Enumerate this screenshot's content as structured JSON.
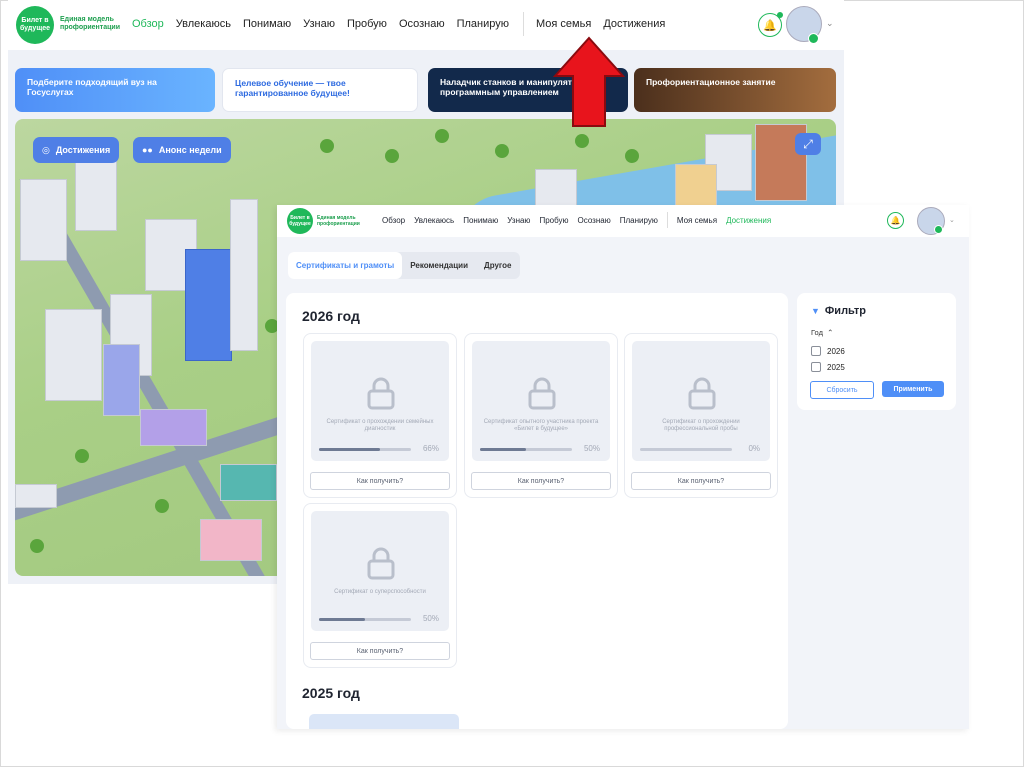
{
  "background": {
    "logo": {
      "text": "Билет в будущее",
      "subtitle": "Единая модель профориентации"
    },
    "nav": [
      "Обзор",
      "Увлекаюсь",
      "Понимаю",
      "Узнаю",
      "Пробую",
      "Осознаю",
      "Планирую"
    ],
    "nav_secondary": [
      "Моя семья",
      "Достижения"
    ],
    "banners": [
      "Подберите подходящий вуз на Госуслугах",
      "Целевое обучение — твое гарантированное будущее!",
      "Наладчик станков и манипуляторов с программным управлением",
      "Профориентационное занятие"
    ],
    "pills": [
      "Достижения",
      "Анонс недели"
    ]
  },
  "foreground": {
    "nav": [
      "Обзор",
      "Увлекаюсь",
      "Понимаю",
      "Узнаю",
      "Пробую",
      "Осознаю",
      "Планирую"
    ],
    "nav_secondary": [
      "Моя семья",
      "Достижения"
    ],
    "tabs": [
      "Сертификаты и грамоты",
      "Рекомендации",
      "Другое"
    ],
    "years": [
      "2026 год",
      "2025 год"
    ],
    "cards": [
      {
        "caption": "Сертификат о прохождении семейных диагностик",
        "percent_label": "66%",
        "progress": 0.66,
        "button": "Как получить?"
      },
      {
        "caption": "Сертификат опытного участника проекта «Билет в будущее»",
        "percent_label": "50%",
        "progress": 0.5,
        "button": "Как получить?"
      },
      {
        "caption": "Сертификат о прохождении профессиональной пробы",
        "percent_label": "0%",
        "progress": 0.0,
        "button": "Как получить?"
      },
      {
        "caption": "Сертификат о суперспособности",
        "percent_label": "50%",
        "progress": 0.5,
        "button": "Как получить?"
      }
    ],
    "filter": {
      "title": "Фильтр",
      "group": "Год",
      "options": [
        "2026",
        "2025"
      ],
      "reset": "Сбросить",
      "apply": "Применить"
    }
  },
  "colors": {
    "brand_green": "#1fb85a",
    "accent_blue": "#4f8ff7",
    "arrow_red": "#e8141c"
  }
}
